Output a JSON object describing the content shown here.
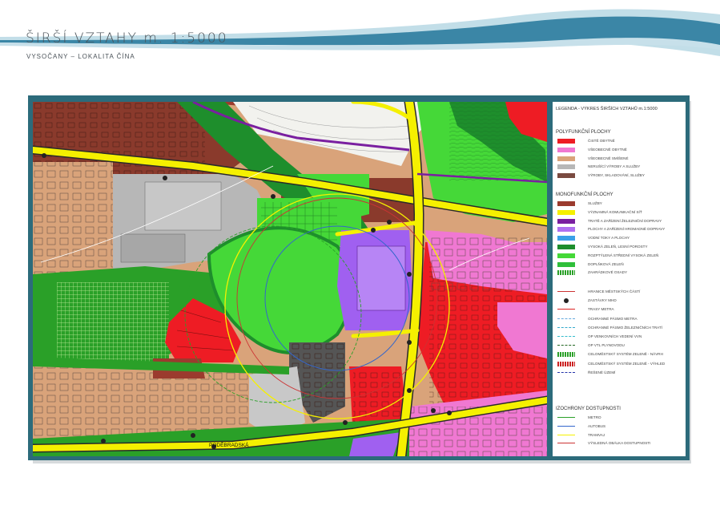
{
  "header": {
    "title": "ŠIRŠÍ VZTAHY m. 1:5000",
    "subtitle": "VYSOČANY – LOKALITA ČÍNA"
  },
  "map": {
    "street_label": "PODĚBRADSKÁ",
    "colors": {
      "residential_pure": "#ee1c24",
      "residential_general": "#f078d2",
      "mixed": "#d9a37a",
      "production": "#b7b7b7",
      "warehouse": "#8a3a2c",
      "services": "#9b3b2e",
      "road": "#f5f000",
      "rail": "#7a1fa0",
      "transit_area": "#a060f0",
      "forest": "#1e8e2c",
      "green": "#45d838",
      "garden": "#2aa028",
      "frame": "#2c6b7b"
    }
  },
  "legend": {
    "title": "LEGENDA - VÝKRES ŠIRŠÍCH VZTAHŮ   m.1:5000",
    "sections": [
      {
        "heading": "POLYFUNKČNÍ PLOCHY",
        "items": [
          {
            "label": "ČISTĚ OBYTNÉ",
            "color": "#ee1c24",
            "kind": "swatch"
          },
          {
            "label": "VŠEOBECNĚ OBYTNÉ",
            "color": "#f078d2",
            "kind": "swatch"
          },
          {
            "label": "VŠEOBECNĚ SMÍŠENÉ",
            "color": "#d9a37a",
            "kind": "swatch"
          },
          {
            "label": "NERUŠÍCÍ VÝROBY A SLUŽBY",
            "color": "#b7b7b7",
            "kind": "swatch"
          },
          {
            "label": "VÝROBY, SKLADOVÁNÍ, SLUŽBY",
            "color": "#7a4a40",
            "kind": "swatch"
          }
        ]
      },
      {
        "heading": "MONOFUNKČNÍ PLOCHY",
        "items": [
          {
            "label": "SLUŽBY",
            "color": "#9b3b2e",
            "kind": "swatch"
          },
          {
            "label": "VÝZNAMNÁ KOMUNIKAČNÍ SÍŤ",
            "color": "#f5f000",
            "kind": "swatch"
          },
          {
            "label": "TRATĚ A ZAŘÍZENÍ ŽELEZNIČNÍ DOPRAVY",
            "color": "#7a1fa0",
            "kind": "swatch"
          },
          {
            "label": "PLOCHY A ZAŘÍZENÍ HROMADNÉ DOPRAVY",
            "color": "#b070f0",
            "kind": "swatch"
          },
          {
            "label": "VODNÍ TOKY A PLOCHY",
            "color": "#3aa0e8",
            "kind": "swatch"
          },
          {
            "label": "VYSOKÁ ZELEŇ, LESNÍ POROSTY",
            "color": "#1e8e2c",
            "kind": "swatch"
          },
          {
            "label": "ROZPTÝLENÁ STŘEDNÍ VYSOKÁ ZELEŇ",
            "color": "#45d838",
            "kind": "swatch"
          },
          {
            "label": "DOPLŇKOVÁ ZELEŇ",
            "color": "#2fbf3a",
            "kind": "swatch"
          },
          {
            "label": "ZAHRÁDKOVÉ OSADY",
            "color": "#2aa028",
            "kind": "hatch"
          }
        ]
      },
      {
        "heading": "",
        "items": [
          {
            "label": "HRANICE MĚSTSKÝCH ČÁSTÍ",
            "color": "#cc3333",
            "kind": "line"
          },
          {
            "label": "ZASTÁVKY MHD",
            "color": "#222222",
            "kind": "dot"
          },
          {
            "label": "TRASY METRA",
            "color": "#dd2222",
            "kind": "line"
          },
          {
            "label": "OCHRANNÉ PÁSMO METRA",
            "color": "#66aadd",
            "kind": "dash"
          },
          {
            "label": "OCHRANNÉ PÁSMO ŽELEZNIČNÍCH TRATÍ",
            "color": "#33aacc",
            "kind": "dash"
          },
          {
            "label": "OP VENKOVNÍCH VEDENÍ VVN",
            "color": "#33bbcc",
            "kind": "dash"
          },
          {
            "label": "OP VTL PLYNOVODU",
            "color": "#226622",
            "kind": "dash"
          },
          {
            "label": "CELOMĚSTSKÝ SYSTÉM ZELENĚ - NÁVRH",
            "color": "#2aa028",
            "kind": "hatch"
          },
          {
            "label": "CELOMĚSTSKÝ SYSTÉM ZELENĚ - VÝHLED",
            "color": "#cc2222",
            "kind": "hatch"
          },
          {
            "label": "ŘEŠENÉ ÚZEMÍ",
            "color": "#2233aa",
            "kind": "dash"
          }
        ]
      },
      {
        "heading": "IZOCHRONY DOSTUPNOSTI",
        "items": [
          {
            "label": "METRO",
            "color": "#2aa028",
            "kind": "line"
          },
          {
            "label": "AUTOBUS",
            "color": "#3366cc",
            "kind": "line"
          },
          {
            "label": "TRAMVAJ",
            "color": "#f5f000",
            "kind": "line"
          },
          {
            "label": "VÝSLEDNÁ OBÁLKA DOSTUPNOSTI",
            "color": "#cc3333",
            "kind": "line"
          }
        ]
      }
    ]
  }
}
